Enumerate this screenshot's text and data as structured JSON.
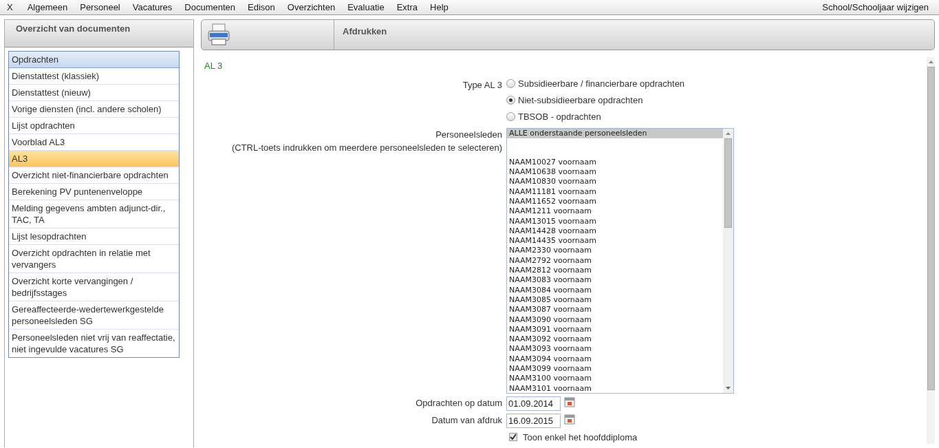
{
  "menu": {
    "items": [
      "X",
      "Algemeen",
      "Personeel",
      "Vacatures",
      "Documenten",
      "Edison",
      "Overzichten",
      "Evaluatie",
      "Extra",
      "Help"
    ],
    "right_link": "School/Schooljaar wijzigen"
  },
  "left_panel": {
    "title": "Overzicht van documenten",
    "items": [
      {
        "label": "Opdrachten",
        "kind": "header",
        "selected": false
      },
      {
        "label": "Dienstattest (klassiek)",
        "kind": "item",
        "selected": false
      },
      {
        "label": "Dienstattest (nieuw)",
        "kind": "item",
        "selected": false
      },
      {
        "label": "Vorige diensten (incl. andere scholen)",
        "kind": "item",
        "selected": false
      },
      {
        "label": "Lijst opdrachten",
        "kind": "item",
        "selected": false
      },
      {
        "label": "Voorblad AL3",
        "kind": "item",
        "selected": false
      },
      {
        "label": "AL3",
        "kind": "item",
        "selected": true
      },
      {
        "label": "Overzicht niet-financierbare opdrachten",
        "kind": "item",
        "selected": false
      },
      {
        "label": "Berekening PV puntenenveloppe",
        "kind": "item",
        "selected": false
      },
      {
        "label": "Melding gegevens ambten adjunct-dir., TAC, TA",
        "kind": "item",
        "selected": false
      },
      {
        "label": "Lijst lesopdrachten",
        "kind": "item",
        "selected": false
      },
      {
        "label": "Overzicht opdrachten in relatie met vervangers",
        "kind": "item",
        "selected": false
      },
      {
        "label": "Overzicht korte vervangingen / bedrijfsstages",
        "kind": "item",
        "selected": false
      },
      {
        "label": "Gereaffecteerde-wedertewerkgestelde personeelsleden SG",
        "kind": "item",
        "selected": false
      },
      {
        "label": "Personeelsleden niet vrij van reaffectatie, niet ingevulde vacatures SG",
        "kind": "item",
        "selected": false
      }
    ]
  },
  "right_panel": {
    "title": "Afdrukken",
    "section_title": "AL 3",
    "type_field": {
      "label": "Type AL 3",
      "options": [
        {
          "label": "Subsidieerbare / financierbare opdrachten",
          "selected": false
        },
        {
          "label": "Niet-subsidieerbare opdrachten",
          "selected": true
        },
        {
          "label": "TBSOB - opdrachten",
          "selected": false
        }
      ]
    },
    "staff_field": {
      "label": "Personeelsleden",
      "hint": "(CTRL-toets indrukken om meerdere personeelsleden te selecteren)",
      "options": [
        {
          "label": "ALLE onderstaande personeelsleden",
          "selected": true
        },
        {
          "label": "NAAM10027 voornaam",
          "selected": false
        },
        {
          "label": "NAAM10638 voornaam",
          "selected": false
        },
        {
          "label": "NAAM10830 voornaam",
          "selected": false
        },
        {
          "label": "NAAM11181 voornaam",
          "selected": false
        },
        {
          "label": "NAAM11652 voornaam",
          "selected": false
        },
        {
          "label": "NAAM1211 voornaam",
          "selected": false
        },
        {
          "label": "NAAM13015 voornaam",
          "selected": false
        },
        {
          "label": "NAAM14428 voornaam",
          "selected": false
        },
        {
          "label": "NAAM14435 voornaam",
          "selected": false
        },
        {
          "label": "NAAM2330 voornaam",
          "selected": false
        },
        {
          "label": "NAAM2792 voornaam",
          "selected": false
        },
        {
          "label": "NAAM2812 voornaam",
          "selected": false
        },
        {
          "label": "NAAM3083 voornaam",
          "selected": false
        },
        {
          "label": "NAAM3084 voornaam",
          "selected": false
        },
        {
          "label": "NAAM3085 voornaam",
          "selected": false
        },
        {
          "label": "NAAM3087 voornaam",
          "selected": false
        },
        {
          "label": "NAAM3090 voornaam",
          "selected": false
        },
        {
          "label": "NAAM3091 voornaam",
          "selected": false
        },
        {
          "label": "NAAM3092 voornaam",
          "selected": false
        },
        {
          "label": "NAAM3093 voornaam",
          "selected": false
        },
        {
          "label": "NAAM3094 voornaam",
          "selected": false
        },
        {
          "label": "NAAM3099 voornaam",
          "selected": false
        },
        {
          "label": "NAAM3100 voornaam",
          "selected": false
        },
        {
          "label": "NAAM3101 voornaam",
          "selected": false
        }
      ]
    },
    "date_fields": [
      {
        "label": "Opdrachten op datum",
        "value": "01.09.2014"
      },
      {
        "label": "Datum van afdruk",
        "value": "16.09.2015"
      }
    ],
    "checkbox": {
      "label": "Toon enkel het hoofddiploma",
      "checked": true
    }
  }
}
